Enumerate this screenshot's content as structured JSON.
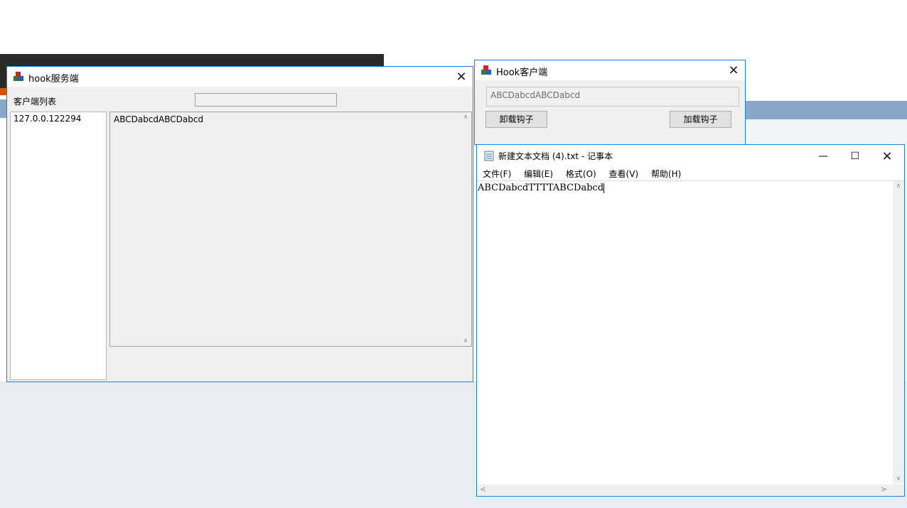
{
  "server_window": {
    "title": "hook服务端",
    "client_list_label": "客户端列表",
    "clients": [
      "127.0.0.122294"
    ],
    "message_text": "ABCDabcdABCDabcd"
  },
  "client_window": {
    "title": "Hook客户端",
    "input_value": "ABCDabcdABCDabcd",
    "unload_button": "卸载钩子",
    "load_button": "加载钩子"
  },
  "notepad": {
    "title": "新建文本文档 (4).txt - 记事本",
    "menu": [
      "文件(F)",
      "编辑(E)",
      "格式(O)",
      "查看(V)",
      "帮助(H)"
    ],
    "content": "ABCDabcdTTTTABCDabcd"
  },
  "icons": {
    "close": "×",
    "minimize": "—",
    "maximize": "☐",
    "scroll_up": "∧",
    "scroll_down": "∨",
    "scroll_left": "<",
    "scroll_right": ">"
  }
}
